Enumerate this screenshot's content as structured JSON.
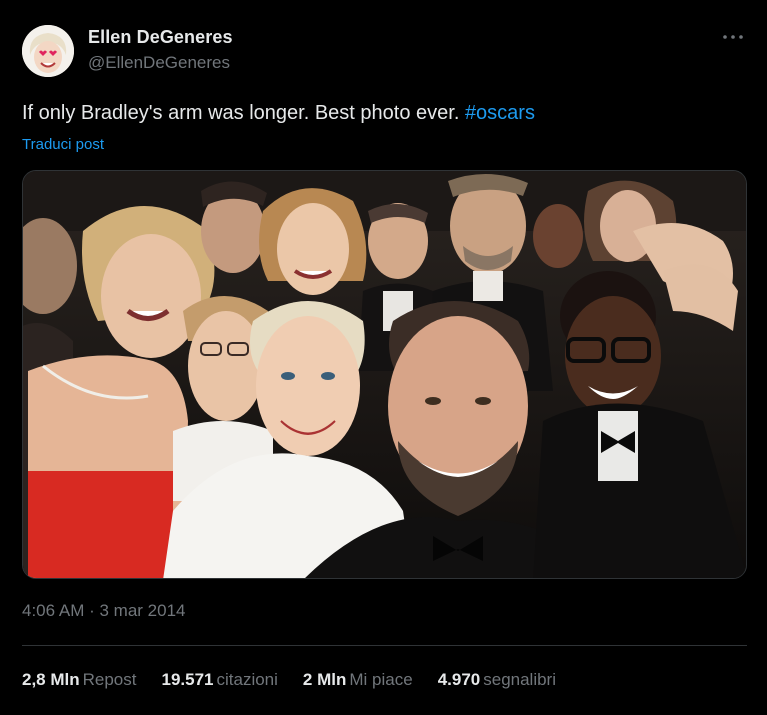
{
  "author": {
    "name": "Ellen DeGeneres",
    "handle": "@EllenDeGeneres"
  },
  "post": {
    "text": "If only Bradley's arm was longer. Best photo ever.",
    "hashtag": "#oscars",
    "translate_label": "Traduci post",
    "photo_description_icon": "group-selfie-photo"
  },
  "meta": {
    "timestamp": "4:06 AM · 3 mar 2014"
  },
  "stats": [
    {
      "value": "2,8 Mln",
      "label": "Repost"
    },
    {
      "value": "19.571",
      "label": "citazioni"
    },
    {
      "value": "2 Mln",
      "label": "Mi piace"
    },
    {
      "value": "4.970",
      "label": "segnalibri"
    }
  ],
  "colors": {
    "background": "#000000",
    "primary_text": "#e7e9ea",
    "secondary_text": "#71767b",
    "link": "#1d9bf0",
    "divider": "#2f3336"
  }
}
